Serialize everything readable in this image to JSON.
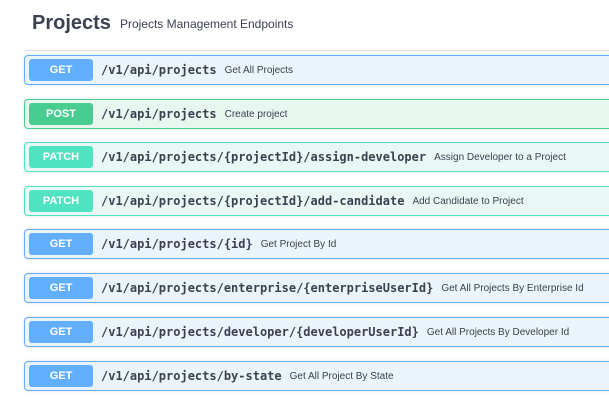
{
  "section": {
    "title": "Projects",
    "description": "Projects Management Endpoints"
  },
  "colors": {
    "get": "#61affe",
    "post": "#49cc90",
    "patch": "#50e3c2",
    "text": "#3b4151"
  },
  "operations": [
    {
      "method": "GET",
      "path": "/v1/api/projects",
      "summary": "Get All Projects"
    },
    {
      "method": "POST",
      "path": "/v1/api/projects",
      "summary": "Create project"
    },
    {
      "method": "PATCH",
      "path": "/v1/api/projects/{projectId}/assign-developer",
      "summary": "Assign Developer to a Project"
    },
    {
      "method": "PATCH",
      "path": "/v1/api/projects/{projectId}/add-candidate",
      "summary": "Add Candidate to Project"
    },
    {
      "method": "GET",
      "path": "/v1/api/projects/{id}",
      "summary": "Get Project By Id"
    },
    {
      "method": "GET",
      "path": "/v1/api/projects/enterprise/{enterpriseUserId}",
      "summary": "Get All Projects By Enterprise Id"
    },
    {
      "method": "GET",
      "path": "/v1/api/projects/developer/{developerUserId}",
      "summary": "Get All Projects By Developer Id"
    },
    {
      "method": "GET",
      "path": "/v1/api/projects/by-state",
      "summary": "Get All Project By State"
    }
  ]
}
